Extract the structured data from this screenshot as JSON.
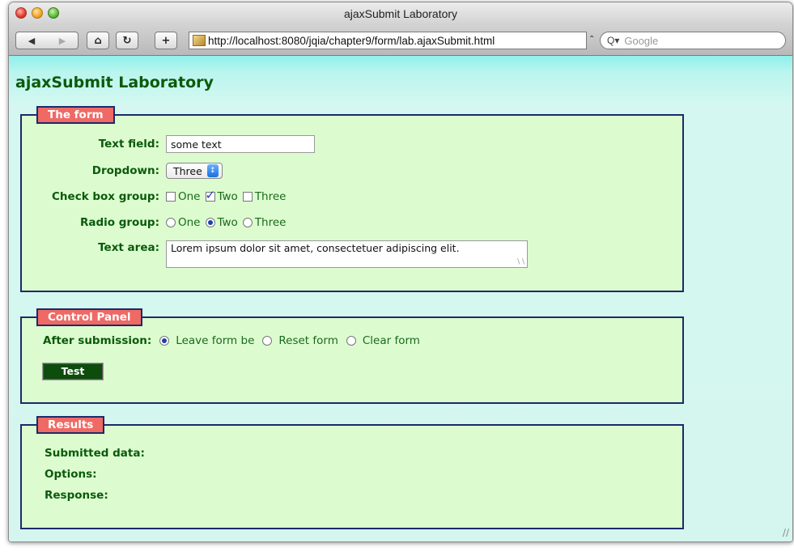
{
  "window": {
    "title": "ajaxSubmit Laboratory"
  },
  "toolbar": {
    "url": "http://localhost:8080/jqia/chapter9/form/lab.ajaxSubmit.html",
    "search_placeholder": "Google"
  },
  "page": {
    "title": "ajaxSubmit Laboratory"
  },
  "form_section": {
    "legend": "The form",
    "text_field": {
      "label": "Text field:",
      "value": "some text"
    },
    "dropdown": {
      "label": "Dropdown:",
      "value": "Three"
    },
    "checkbox_group": {
      "label": "Check box group:",
      "options": [
        {
          "label": "One",
          "checked": false
        },
        {
          "label": "Two",
          "checked": true
        },
        {
          "label": "Three",
          "checked": false
        }
      ]
    },
    "radio_group": {
      "label": "Radio group:",
      "options": [
        {
          "label": "One",
          "checked": false
        },
        {
          "label": "Two",
          "checked": true
        },
        {
          "label": "Three",
          "checked": false
        }
      ]
    },
    "text_area": {
      "label": "Text area:",
      "value": "Lorem ipsum dolor sit amet, consectetuer adipiscing elit."
    }
  },
  "control_panel": {
    "legend": "Control Panel",
    "after_submission_label": "After submission:",
    "options": [
      {
        "label": "Leave form be",
        "checked": true
      },
      {
        "label": "Reset form",
        "checked": false
      },
      {
        "label": "Clear form",
        "checked": false
      }
    ],
    "test_button": "Test"
  },
  "results": {
    "legend": "Results",
    "submitted_data_label": "Submitted data:",
    "options_label": "Options:",
    "response_label": "Response:"
  }
}
